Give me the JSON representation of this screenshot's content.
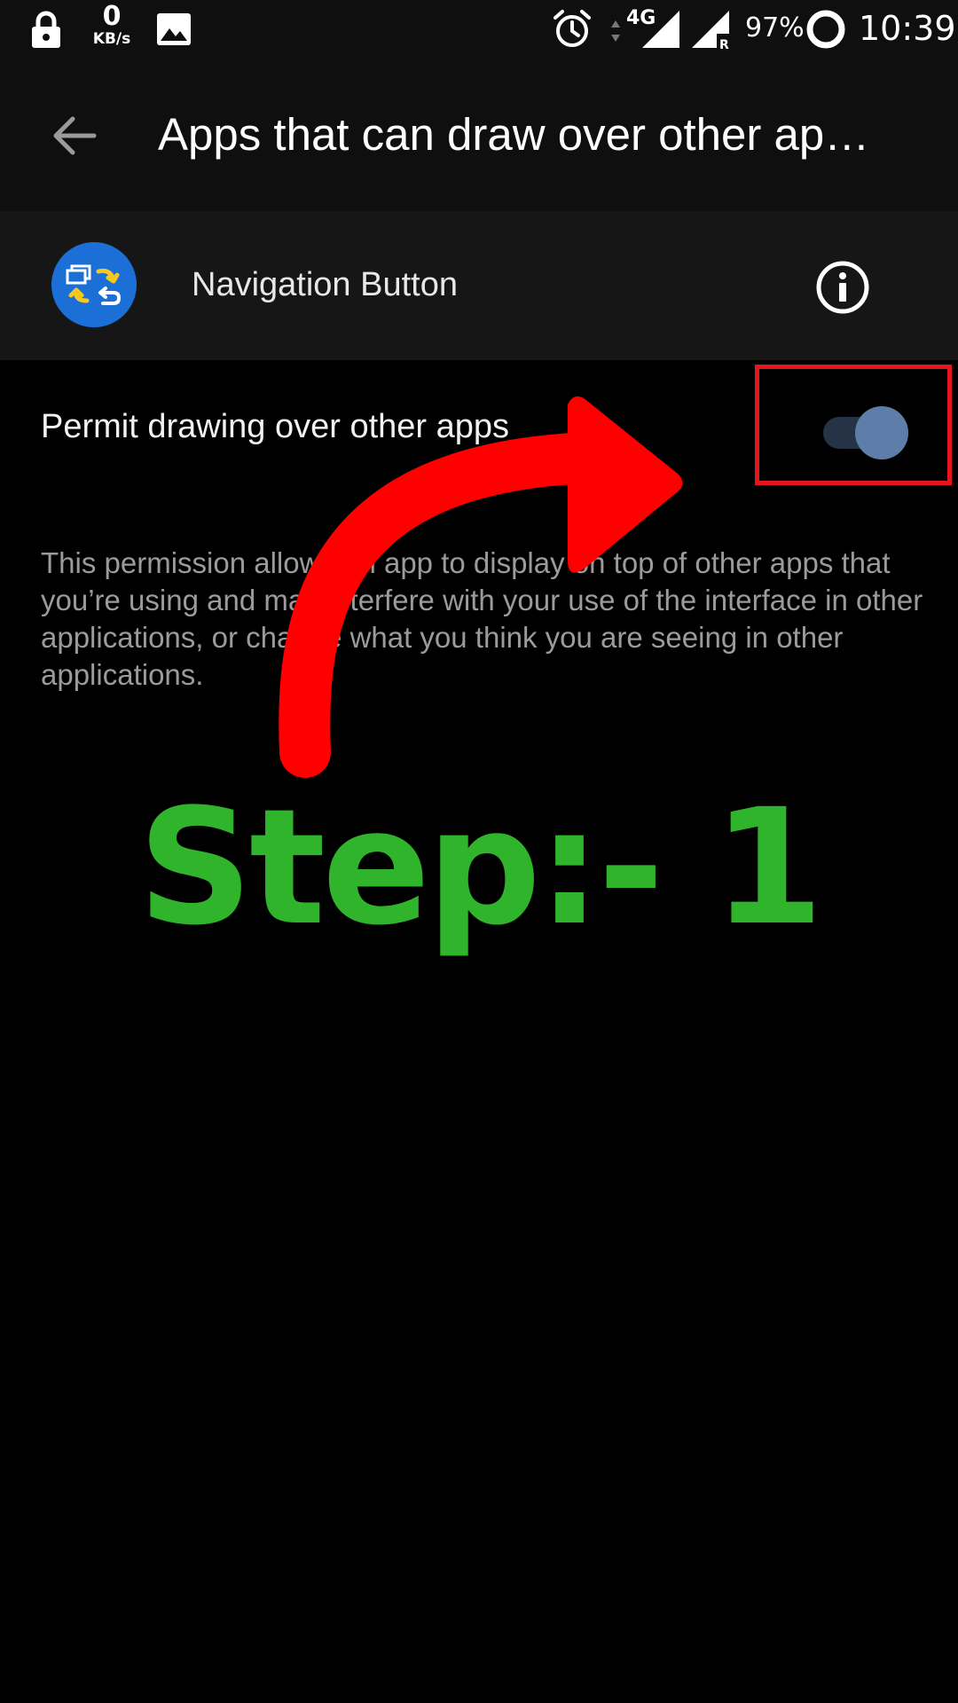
{
  "status_bar": {
    "net_speed_value": "0",
    "net_speed_unit": "KB/s",
    "network_type": "4G",
    "battery_percent": "97%",
    "time": "10:39",
    "icons": [
      "lock-icon",
      "image-icon",
      "alarm-icon",
      "data-arrows-icon",
      "signal-icon",
      "roaming-signal-icon",
      "battery-icon"
    ]
  },
  "toolbar": {
    "back_icon": "arrow-back-icon",
    "title": "Apps that can draw over other ap…"
  },
  "app": {
    "name": "Navigation Button",
    "icon": "navigation-button-app-icon",
    "info_icon": "info-icon"
  },
  "permission": {
    "label": "Permit drawing over other apps",
    "enabled": true,
    "description": "This permission allows an app to display on top of other apps that you’re using and may interfere with your use of the interface in other applications, or change what you think you are seeing in other applications."
  },
  "annotation": {
    "step_text": "Step:- 1",
    "arrow_color": "#ff0000",
    "highlight_color": "#e8141b",
    "step_color": "#2fb42c"
  },
  "colors": {
    "background": "#000000",
    "toolbar": "#0f0f0f",
    "header": "#161616",
    "toggle_thumb": "#5d7ea8",
    "toggle_track": "#263245"
  }
}
